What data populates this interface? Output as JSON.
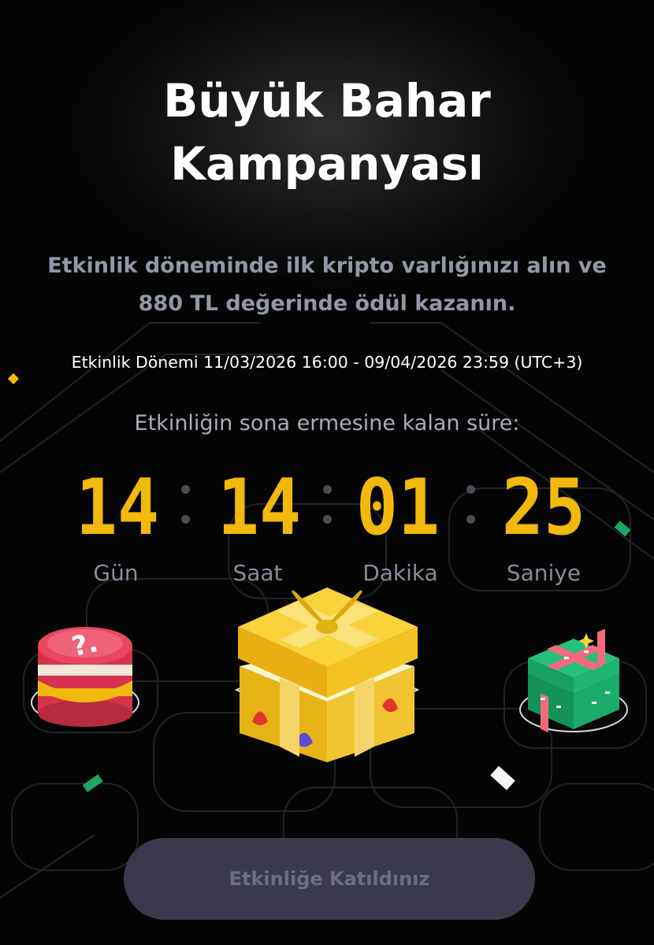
{
  "campaign": {
    "title_line1": "Büyük Bahar",
    "title_line2": "Kampanyası",
    "subtitle_line1": "Etkinlik döneminde ilk kripto varlığınızı alın ve",
    "subtitle_line2": "880 TL değerinde ödül kazanın.",
    "period": "Etkinlik Dönemi 11/03/2026 16:00 - 09/04/2026 23:59 (UTC+3)"
  },
  "countdown": {
    "label": "Etkinliğin sona ermesine kalan süre:",
    "days": "14",
    "hours": "14",
    "minutes": "01",
    "seconds": "25",
    "days_label": "Gün",
    "hours_label": "Saat",
    "minutes_label": "Dakika",
    "seconds_label": "Saniye"
  },
  "rewards": [
    {
      "icon": "mystery-coin-stack-icon"
    },
    {
      "icon": "golden-gift-box-icon"
    },
    {
      "icon": "green-gift-box-icon"
    }
  ],
  "cta": {
    "label": "Etkinliğe Katıldınız"
  },
  "colors": {
    "background": "#050505",
    "accent": "#f0b90b",
    "muted_text": "#9298a6",
    "button_bg": "#3a3a4c",
    "button_text": "#6e7080"
  }
}
